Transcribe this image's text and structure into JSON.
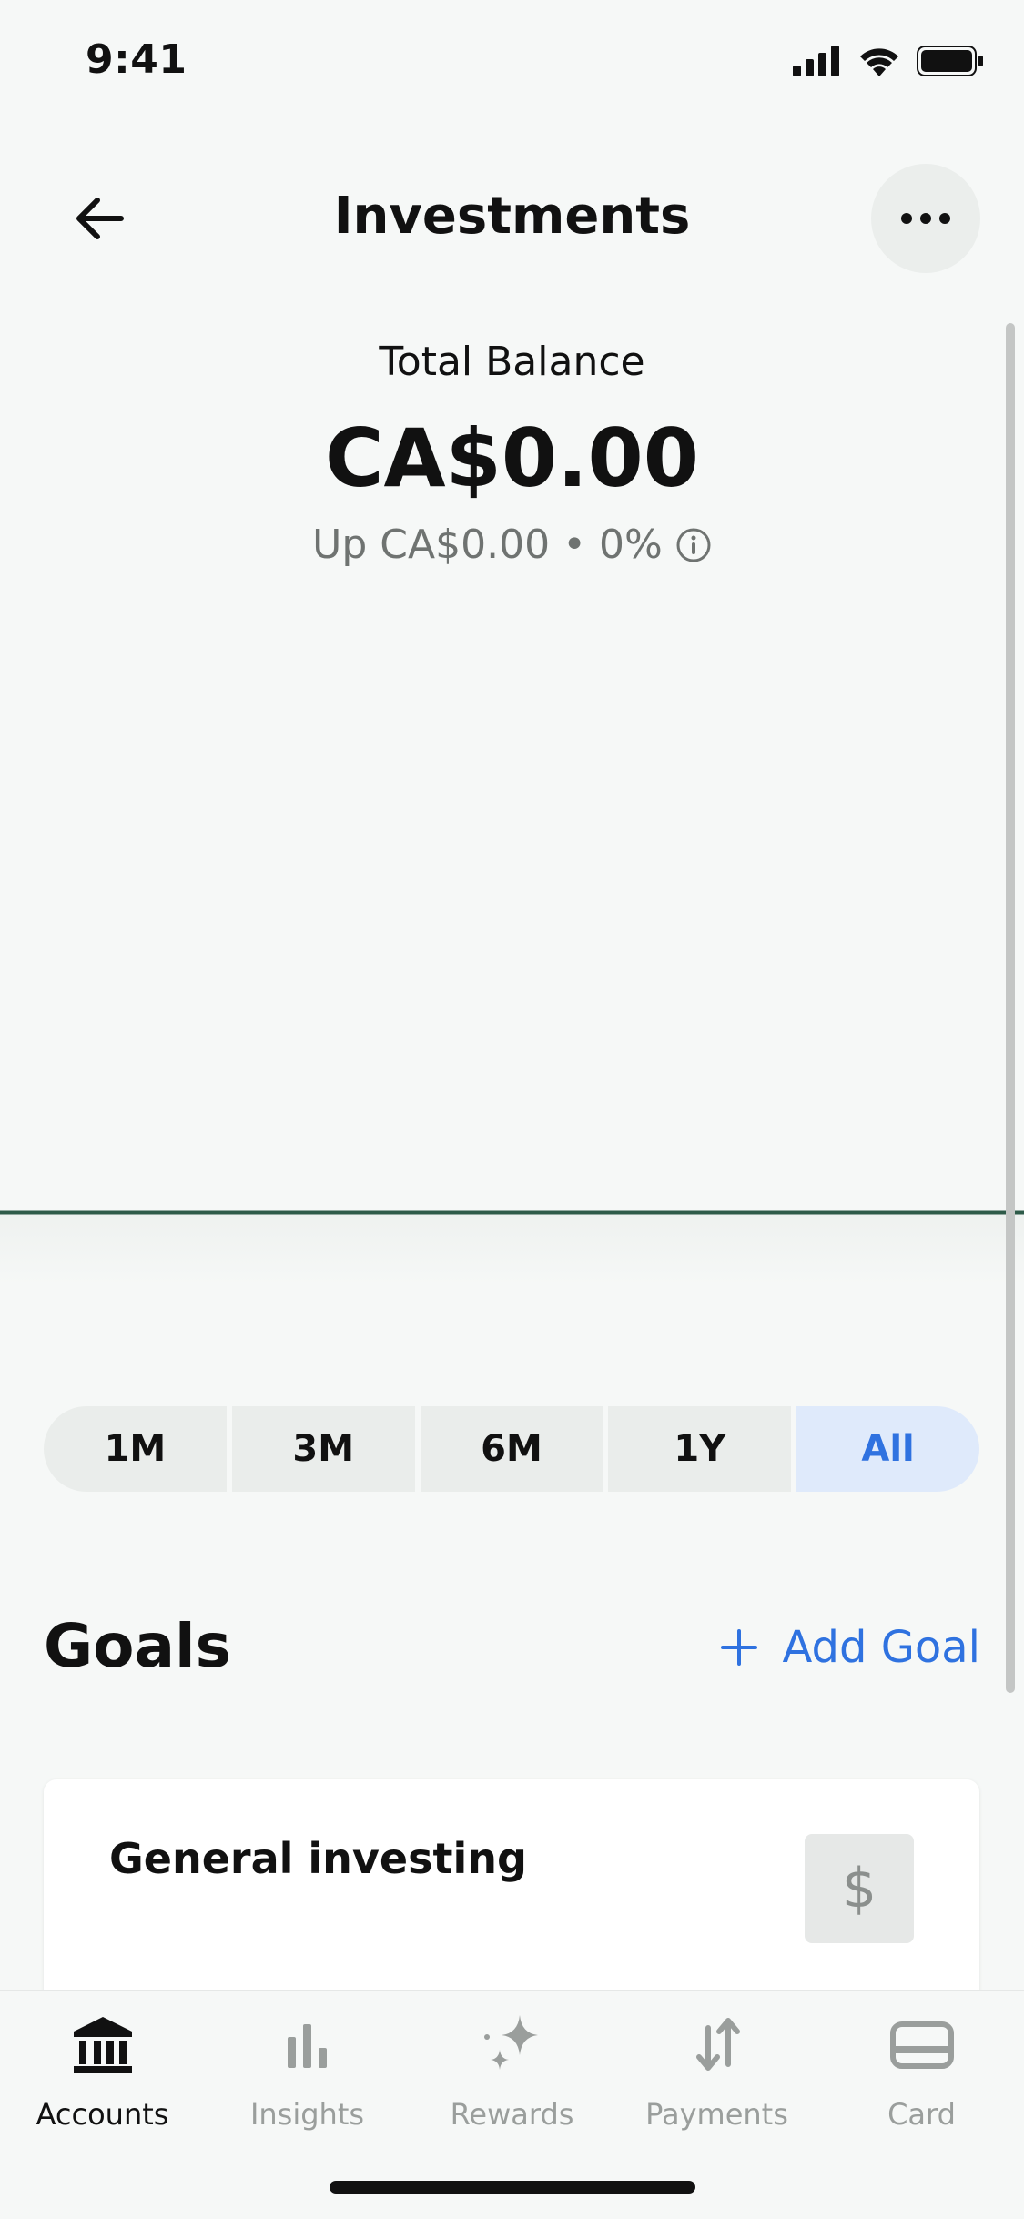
{
  "status_bar": {
    "time": "9:41"
  },
  "header": {
    "title": "Investments"
  },
  "balance": {
    "label": "Total Balance",
    "value": "CA$0.00",
    "change_text": "Up CA$0.00",
    "separator": "•",
    "change_percent": "0%"
  },
  "range_tabs": [
    {
      "label": "1M",
      "selected": false
    },
    {
      "label": "3M",
      "selected": false
    },
    {
      "label": "6M",
      "selected": false
    },
    {
      "label": "1Y",
      "selected": false
    },
    {
      "label": "All",
      "selected": true
    }
  ],
  "goals": {
    "title": "Goals",
    "add_label": "Add Goal",
    "cards": [
      {
        "name": "General investing",
        "icon_glyph": "$"
      }
    ]
  },
  "tab_bar": {
    "items": [
      {
        "label": "Accounts",
        "icon": "bank-icon",
        "active": true
      },
      {
        "label": "Insights",
        "icon": "bar-chart-icon",
        "active": false
      },
      {
        "label": "Rewards",
        "icon": "sparkle-icon",
        "active": false
      },
      {
        "label": "Payments",
        "icon": "transfer-arrows-icon",
        "active": false
      },
      {
        "label": "Card",
        "icon": "card-icon",
        "active": false
      }
    ]
  },
  "colors": {
    "accent": "#2f72e0",
    "chart_line": "#2e5b49",
    "background": "#f6f8f7"
  }
}
